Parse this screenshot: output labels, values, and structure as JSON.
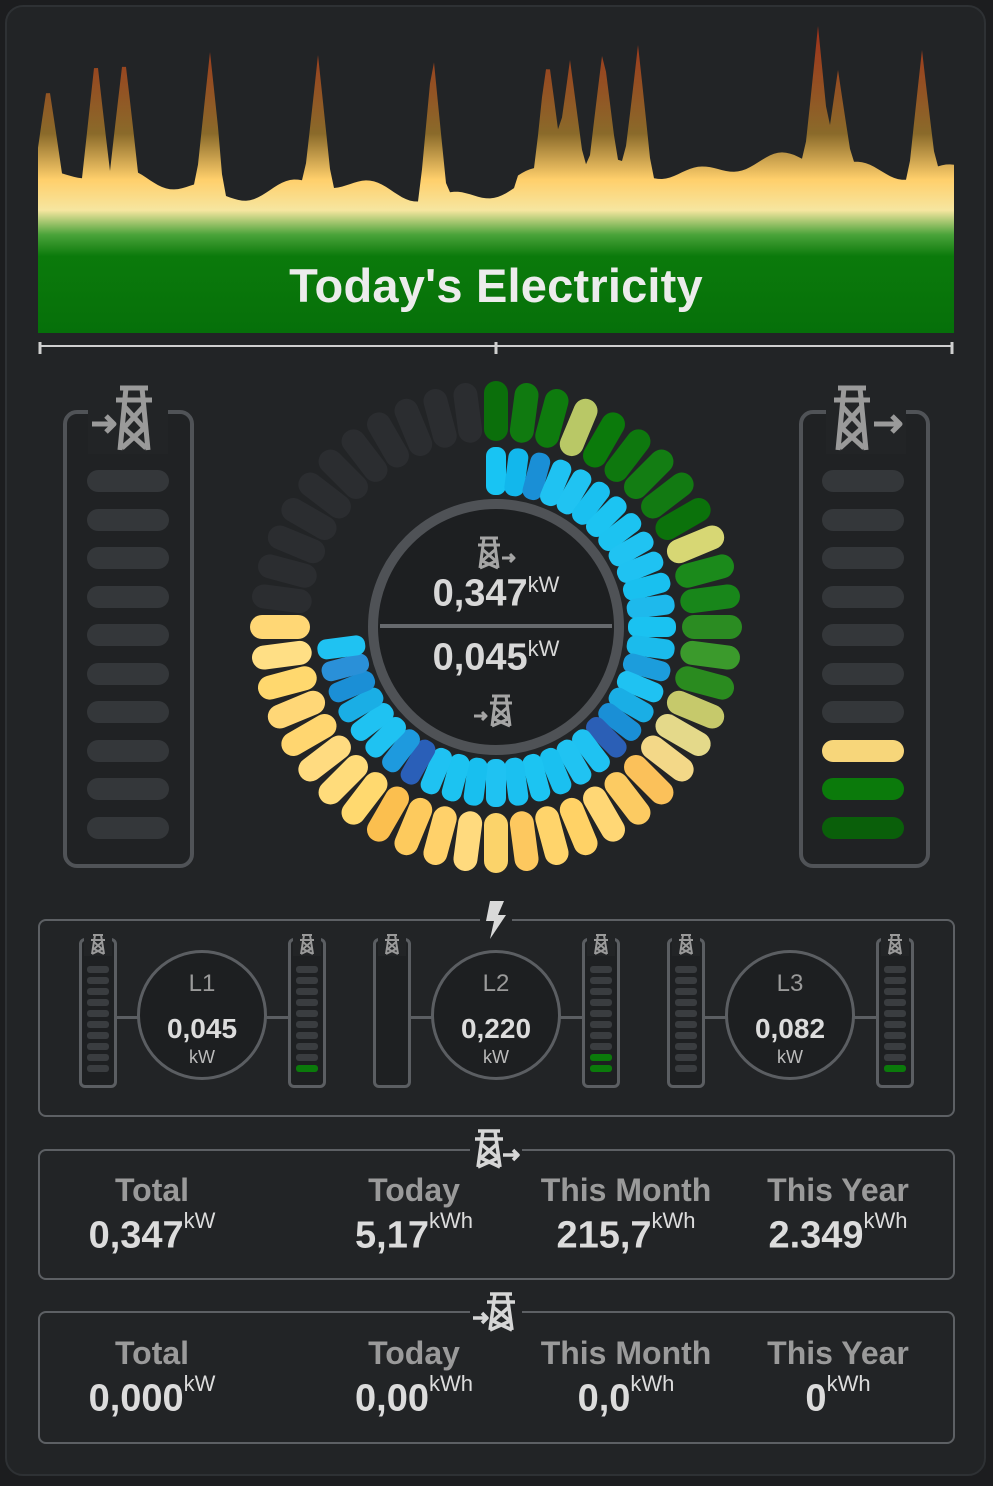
{
  "header": {
    "title": "Today's Electricity"
  },
  "gauge": {
    "import_value": "0,347",
    "import_unit": "kW",
    "export_value": "0,045",
    "export_unit": "kW"
  },
  "left_bar": {
    "label": "import-tower-icon",
    "lit_segments": 0,
    "total_segments": 10
  },
  "right_bar": {
    "label": "export-tower-icon",
    "lit_segments": 3,
    "total_segments": 10,
    "lit_colors": [
      "#f7d67a",
      "#0b7a0b",
      "#0a5f0a"
    ]
  },
  "phases": [
    {
      "label": "L1",
      "value": "0,045",
      "unit": "kW",
      "import_level": 0,
      "export_level": 1
    },
    {
      "label": "L2",
      "value": "0,220",
      "unit": "kW",
      "import_level": 0,
      "export_level": 2
    },
    {
      "label": "L3",
      "value": "0,082",
      "unit": "kW",
      "import_level": 0,
      "export_level": 1
    }
  ],
  "import_stats": {
    "labels": [
      "Total",
      "Today",
      "This Month",
      "This Year"
    ],
    "values": [
      "0,347",
      "5,17",
      "215,7",
      "2.349"
    ],
    "units": [
      "kW",
      "kWh",
      "kWh",
      "kWh"
    ]
  },
  "export_stats": {
    "labels": [
      "Total",
      "Today",
      "This Month",
      "This Year"
    ],
    "values": [
      "0,000",
      "0,00",
      "0,0",
      "0"
    ],
    "units": [
      "kW",
      "kWh",
      "kWh",
      "kWh"
    ]
  },
  "colors": {
    "accent_green": "#0a7d0a",
    "accent_yellow": "#ffd36e",
    "accent_blue": "#1fc2f2"
  }
}
